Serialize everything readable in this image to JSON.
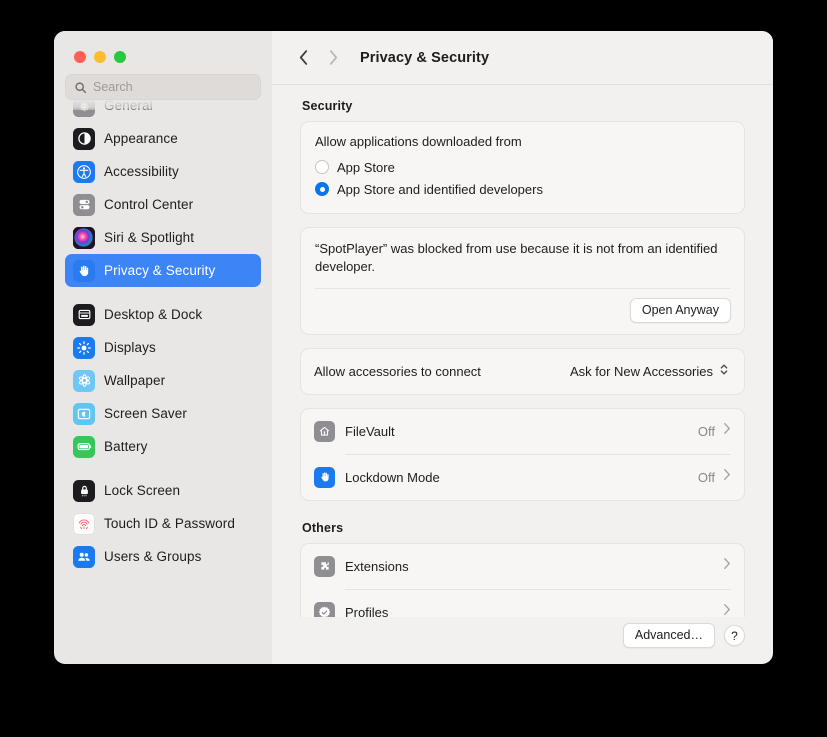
{
  "window": {
    "title": "Privacy & Security",
    "traffic_lights": [
      "close",
      "minimize",
      "zoom"
    ]
  },
  "toolbar": {
    "back_label": "‹",
    "forward_label": "›"
  },
  "search": {
    "placeholder": "Search",
    "value": ""
  },
  "sidebar": {
    "items": [
      {
        "label": "General",
        "icon": "gear-icon",
        "selected": false,
        "clipped": true
      },
      {
        "label": "Appearance",
        "icon": "appearance-icon",
        "selected": false
      },
      {
        "label": "Accessibility",
        "icon": "accessibility-icon",
        "selected": false
      },
      {
        "label": "Control Center",
        "icon": "control-center-icon",
        "selected": false
      },
      {
        "label": "Siri & Spotlight",
        "icon": "siri-icon",
        "selected": false
      },
      {
        "label": "Privacy & Security",
        "icon": "hand-icon",
        "selected": true
      },
      {
        "label": "Desktop & Dock",
        "icon": "desktop-dock-icon",
        "selected": false
      },
      {
        "label": "Displays",
        "icon": "displays-icon",
        "selected": false
      },
      {
        "label": "Wallpaper",
        "icon": "wallpaper-icon",
        "selected": false
      },
      {
        "label": "Screen Saver",
        "icon": "screen-saver-icon",
        "selected": false
      },
      {
        "label": "Battery",
        "icon": "battery-icon",
        "selected": false
      },
      {
        "label": "Lock Screen",
        "icon": "lock-screen-icon",
        "selected": false
      },
      {
        "label": "Touch ID & Password",
        "icon": "touch-id-icon",
        "selected": false
      },
      {
        "label": "Users & Groups",
        "icon": "users-groups-icon",
        "selected": false
      }
    ]
  },
  "main": {
    "security_section": {
      "title": "Security",
      "allow_apps": {
        "label": "Allow applications downloaded from",
        "options": [
          {
            "label": "App Store",
            "selected": false
          },
          {
            "label": "App Store and identified developers",
            "selected": true
          }
        ]
      },
      "blocked_notice": {
        "text": "“SpotPlayer” was blocked from use because it is not from an identified developer.",
        "button_label": "Open Anyway"
      },
      "accessories": {
        "label": "Allow accessories to connect",
        "value": "Ask for New Accessories"
      },
      "rows": [
        {
          "label": "FileVault",
          "value": "Off",
          "icon": "filevault-icon",
          "chevron": "›"
        },
        {
          "label": "Lockdown Mode",
          "value": "Off",
          "icon": "lockdown-mode-icon",
          "chevron": "›"
        }
      ]
    },
    "others_section": {
      "title": "Others",
      "rows": [
        {
          "label": "Extensions",
          "value": "",
          "icon": "extensions-icon",
          "chevron": "›"
        },
        {
          "label": "Profiles",
          "value": "",
          "icon": "profiles-icon",
          "chevron": "›"
        }
      ]
    },
    "footer": {
      "advanced_label": "Advanced…",
      "help_label": "?"
    }
  },
  "colors": {
    "selection_blue": "#3d84f7",
    "radio_blue": "#0b75ef",
    "sidebar_bg": "#e9e7e5",
    "content_bg": "#f3f1ef",
    "card_bg": "#f7f6f4"
  }
}
